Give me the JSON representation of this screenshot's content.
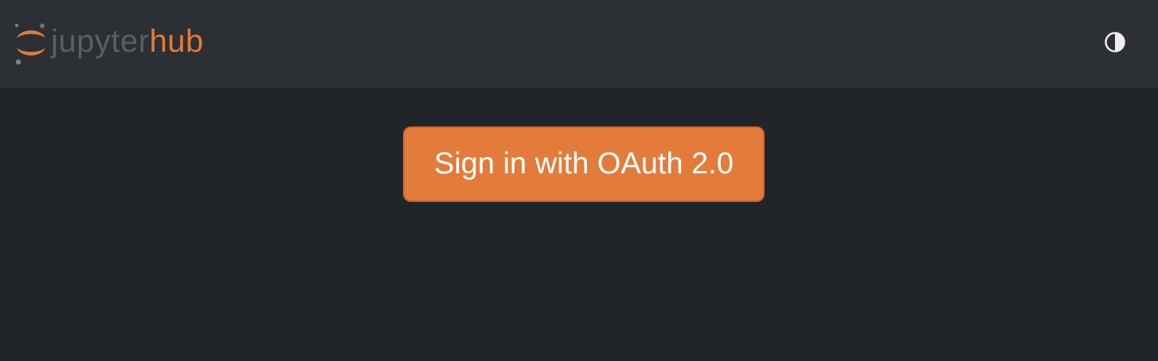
{
  "header": {
    "logo": {
      "text_part_a": "jupyter",
      "text_part_b": "hub",
      "icon": "jupyter-logo-icon"
    },
    "theme_toggle": {
      "icon": "contrast-half-circle-icon"
    }
  },
  "main": {
    "oauth_button_label": "Sign in with OAuth 2.0"
  },
  "colors": {
    "page_background": "#212429",
    "navbar_background": "#2c2f34",
    "brand_orange": "#e37b36",
    "logo_gray": "#5b5e63",
    "button_background": "#e37b3a",
    "button_border": "#d0652a",
    "toggle_icon": "#eeeeee"
  }
}
